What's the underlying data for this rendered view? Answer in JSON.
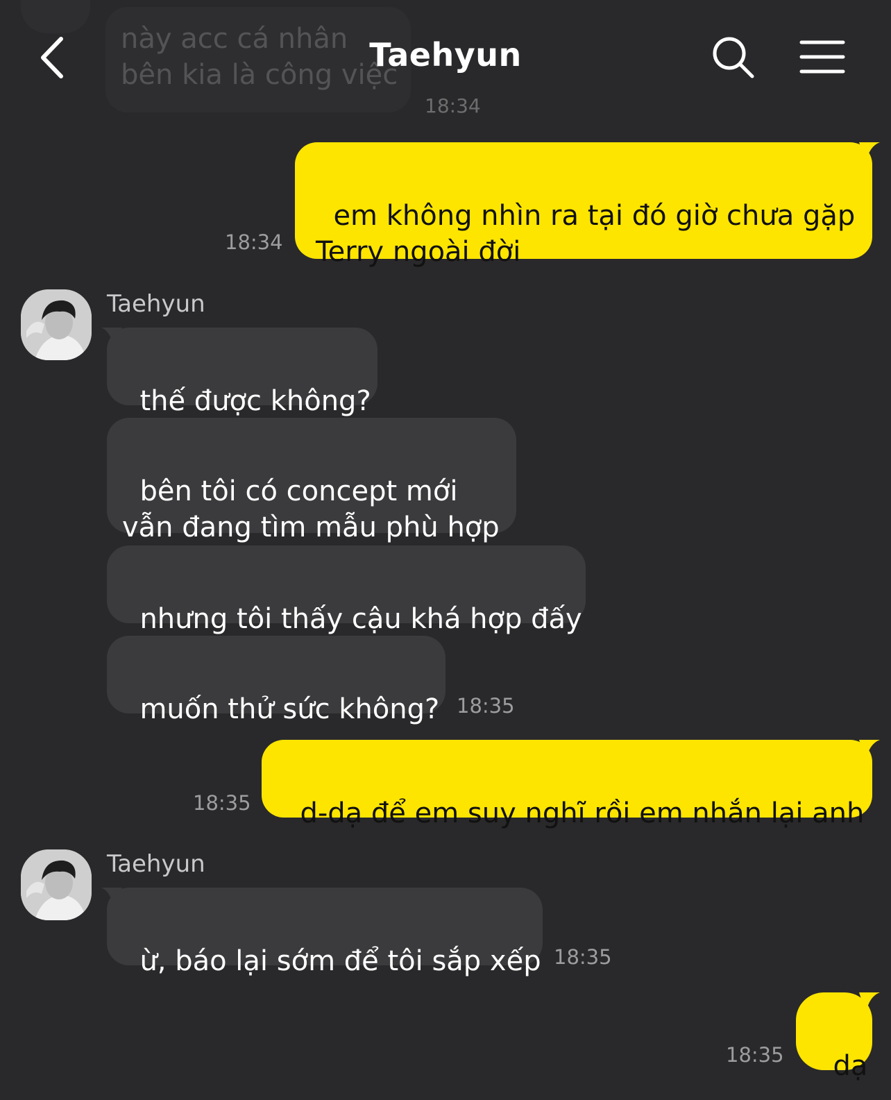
{
  "header": {
    "title": "Taehyun",
    "back_icon": "chevron-left-icon",
    "search_icon": "search-icon",
    "menu_icon": "hamburger-menu-icon"
  },
  "faded_message": {
    "text": "này acc cá nhân\nbên kia là công việc",
    "time": "18:34"
  },
  "messages": [
    {
      "from": "me",
      "text": "em không nhìn ra tại đó giờ chưa gặp\nTerry ngoài đời",
      "time": "18:34"
    },
    {
      "from": "Taehyun",
      "sender": "Taehyun",
      "text": "thế được không?"
    },
    {
      "from": "Taehyun",
      "text": "bên tôi có concept mới\nvẫn đang tìm mẫu phù hợp"
    },
    {
      "from": "Taehyun",
      "text": "nhưng tôi thấy cậu khá hợp đấy"
    },
    {
      "from": "Taehyun",
      "text": "muốn thử sức không?",
      "time": "18:35"
    },
    {
      "from": "me",
      "text": "d-dạ để em suy nghĩ rồi em nhắn lại anh",
      "time": "18:35"
    },
    {
      "from": "Taehyun",
      "sender": "Taehyun",
      "text": "ừ, báo lại sớm để tôi sắp xếp",
      "time": "18:35"
    },
    {
      "from": "me",
      "text": "dạ",
      "time": "18:35"
    }
  ],
  "colors": {
    "background": "#29292b",
    "incoming_bubble": "#3b3b3d",
    "outgoing_bubble": "#fee500"
  }
}
